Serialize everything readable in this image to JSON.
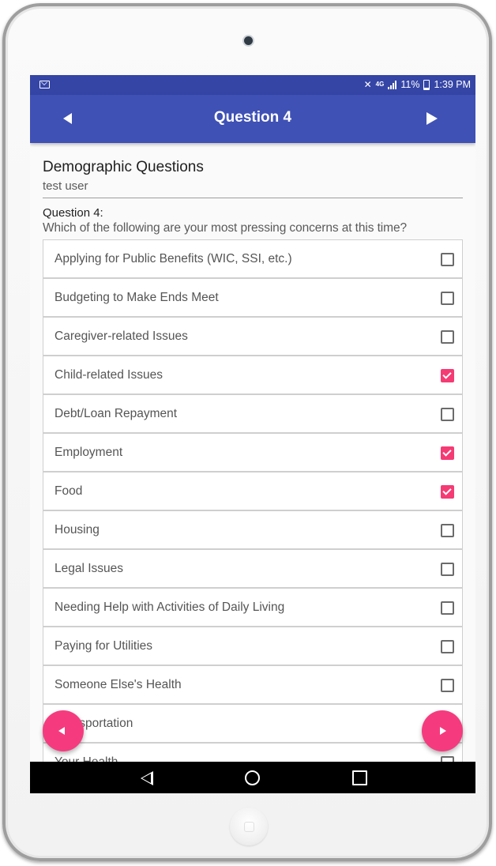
{
  "status_bar": {
    "mail_icon": "mail-icon",
    "network": "4G",
    "battery_percent": "11%",
    "time": "1:39 PM"
  },
  "app_bar": {
    "title": "Question 4",
    "prev_icon": "arrow-left-icon",
    "next_icon": "arrow-right-icon"
  },
  "section": {
    "title": "Demographic Questions",
    "user": "test user"
  },
  "question": {
    "number": "Question 4:",
    "text": "Which of the following are your most pressing concerns at this time?",
    "options": [
      {
        "label": "Applying for Public Benefits (WIC, SSI, etc.)",
        "checked": false
      },
      {
        "label": "Budgeting to Make Ends Meet",
        "checked": false
      },
      {
        "label": "Caregiver-related Issues",
        "checked": false
      },
      {
        "label": "Child-related Issues",
        "checked": true
      },
      {
        "label": "Debt/Loan Repayment",
        "checked": false
      },
      {
        "label": "Employment",
        "checked": true
      },
      {
        "label": "Food",
        "checked": true
      },
      {
        "label": "Housing",
        "checked": false
      },
      {
        "label": "Legal Issues",
        "checked": false
      },
      {
        "label": "Needing Help with Activities of Daily Living",
        "checked": false
      },
      {
        "label": "Paying for Utilities",
        "checked": false
      },
      {
        "label": "Someone Else's Health",
        "checked": false
      },
      {
        "label": "Transportation",
        "checked": false
      },
      {
        "label": "Your Health",
        "checked": false
      }
    ]
  },
  "colors": {
    "primary": "#3f51b5",
    "status_bar": "#3545a6",
    "accent": "#f53b74"
  },
  "nav_bar": {
    "back_icon": "back-icon",
    "home_icon": "home-icon",
    "recents_icon": "recents-icon"
  }
}
